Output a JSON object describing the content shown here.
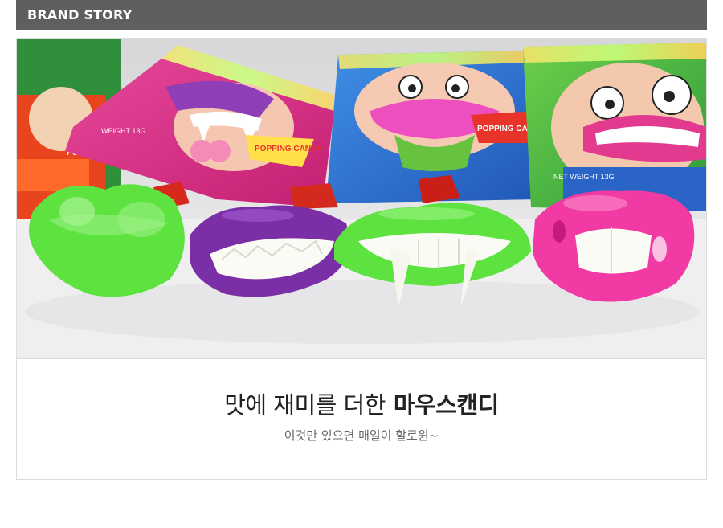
{
  "section": {
    "title": "BRAND STORY"
  },
  "photo": {
    "subject": "candy-packs-and-lip-shaped-candies",
    "package_text_left": "POPPING CANDY",
    "package_text_right": "POPPING CANDY",
    "package_weight": "WEIGHT 13G",
    "package_weight_right": "NET WEIGHT 13G",
    "colors": {
      "green": "#5ee23f",
      "purple": "#7b2fa6",
      "pink": "#f23aa4",
      "teeth": "#fbfbf6"
    }
  },
  "caption": {
    "headline_light": "맛에 재미를 더한",
    "headline_bold": "마우스캔디",
    "subline": "이것만 있으면 매일이 할로윈~"
  }
}
